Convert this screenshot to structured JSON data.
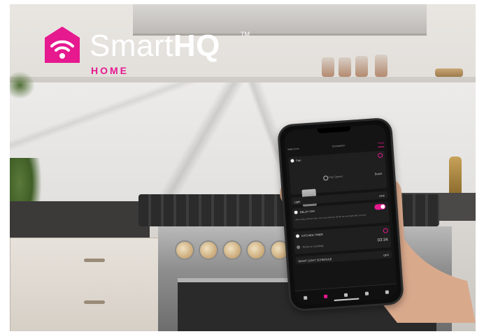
{
  "logo": {
    "word_light": "Smart",
    "word_bold": "HQ",
    "trademark": "TM",
    "subtitle": "HOME",
    "brand_color": "#e6198f"
  },
  "phone": {
    "tabs": [
      "Wall Oven",
      "Dishwasher",
      "Hood"
    ],
    "active_tab": "Hood",
    "fan": {
      "label": "Fan",
      "status": "Fan Speed",
      "value": "Boost"
    },
    "light": {
      "label": "Light",
      "value": "OFF"
    },
    "delay_off": {
      "label": "DELAY OFF",
      "toggle_on": true,
      "description": "After delay off timer time, the hood will turn off the fan and light after set time."
    },
    "kitchen_timer": {
      "label": "KITCHEN TIMER",
      "value": "03:34",
      "sub": "Timer is counting"
    },
    "night_light": {
      "label": "NIGHT LIGHT SCHEDULE",
      "value": "OFF"
    },
    "nav": [
      "Home",
      "Hood",
      "Recipes",
      "Discover",
      "Settings"
    ],
    "active_nav": "Hood",
    "accent_color": "#e6198f"
  }
}
